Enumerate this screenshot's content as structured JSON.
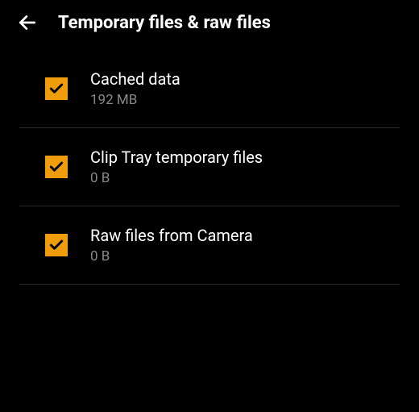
{
  "header": {
    "title": "Temporary files & raw files"
  },
  "items": [
    {
      "label": "Cached data",
      "size": "192 MB",
      "checked": true
    },
    {
      "label": "Clip Tray temporary files",
      "size": "0 B",
      "checked": true
    },
    {
      "label": "Raw files from Camera",
      "size": "0 B",
      "checked": true
    }
  ],
  "colors": {
    "accent": "#ef9d0d",
    "background": "#000000",
    "text": "#ffffff",
    "subtext": "#888888",
    "divider": "#2a2a2a"
  }
}
